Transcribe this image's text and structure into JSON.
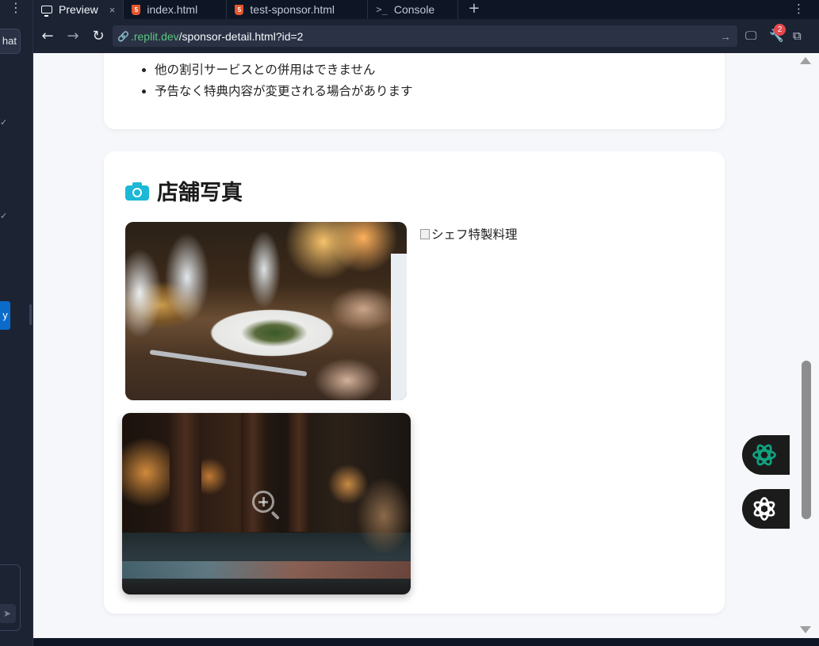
{
  "tabs": [
    {
      "label": "Preview",
      "active": true,
      "icon": "monitor-icon",
      "closable": true
    },
    {
      "label": "index.html",
      "active": false,
      "icon": "html5-icon"
    },
    {
      "label": "test-sponsor.html",
      "active": false,
      "icon": "html5-icon"
    },
    {
      "label": "Console",
      "active": false,
      "icon": "terminal-icon"
    }
  ],
  "address": {
    "host": ".replit.dev",
    "path": "/sponsor-detail.html?id=2",
    "badge_count": "2"
  },
  "sidebar": {
    "chat_label": "hat"
  },
  "notes": [
    "他の割引サービスとの併用はできません",
    "予告なく特典内容が変更される場合があります"
  ],
  "photos_section": {
    "title": "店舗写真",
    "broken_image_alt": "シェフ特製料理"
  },
  "colors": {
    "accent": "#1cb8d6",
    "url_host": "#58c77d",
    "badge": "#e5484d",
    "chatgpt_green": "#10a37f"
  }
}
